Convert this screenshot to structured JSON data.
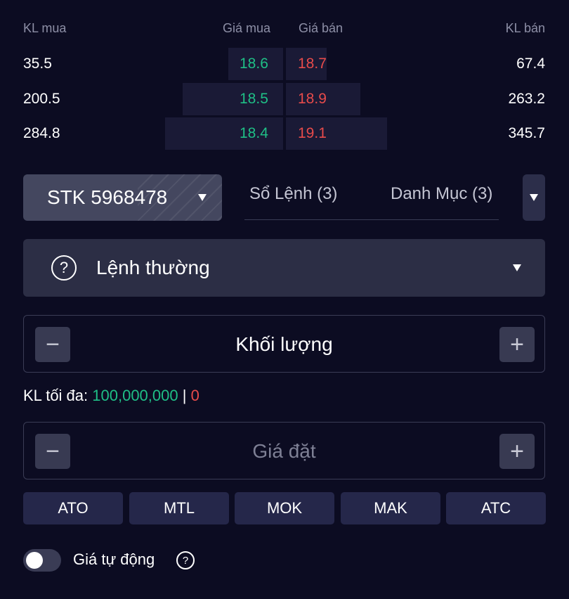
{
  "order_book": {
    "headers": {
      "buy_vol": "KL mua",
      "buy_price": "Giá mua",
      "sell_price": "Giá bán",
      "sell_vol": "KL bán"
    },
    "rows": [
      {
        "buy_vol": "35.5",
        "buy_price": "18.6",
        "sell_price": "18.7",
        "sell_vol": "67.4"
      },
      {
        "buy_vol": "200.5",
        "buy_price": "18.5",
        "sell_price": "18.9",
        "sell_vol": "263.2"
      },
      {
        "buy_vol": "284.8",
        "buy_price": "18.4",
        "sell_price": "19.1",
        "sell_vol": "345.7"
      }
    ]
  },
  "account": {
    "label": "STK 5968478"
  },
  "tabs": [
    {
      "label": "Sổ Lệnh (3)"
    },
    {
      "label": "Danh Mục (3)"
    }
  ],
  "order_type": {
    "label": "Lệnh thường",
    "help": "?"
  },
  "quantity": {
    "placeholder": "Khối lượng",
    "minus": "−",
    "plus": "+"
  },
  "max_qty": {
    "label": "KL tối đa:",
    "value": "100,000,000",
    "separator": "|",
    "zero": "0"
  },
  "price": {
    "placeholder": "Giá đặt",
    "minus": "−",
    "plus": "+"
  },
  "quick_orders": [
    "ATO",
    "MTL",
    "MOK",
    "MAK",
    "ATC"
  ],
  "auto_price": {
    "label": "Giá tự động",
    "help": "?",
    "enabled": false
  },
  "colors": {
    "buy": "#1fbf86",
    "sell": "#e74b4b",
    "background": "#0c0c22"
  }
}
